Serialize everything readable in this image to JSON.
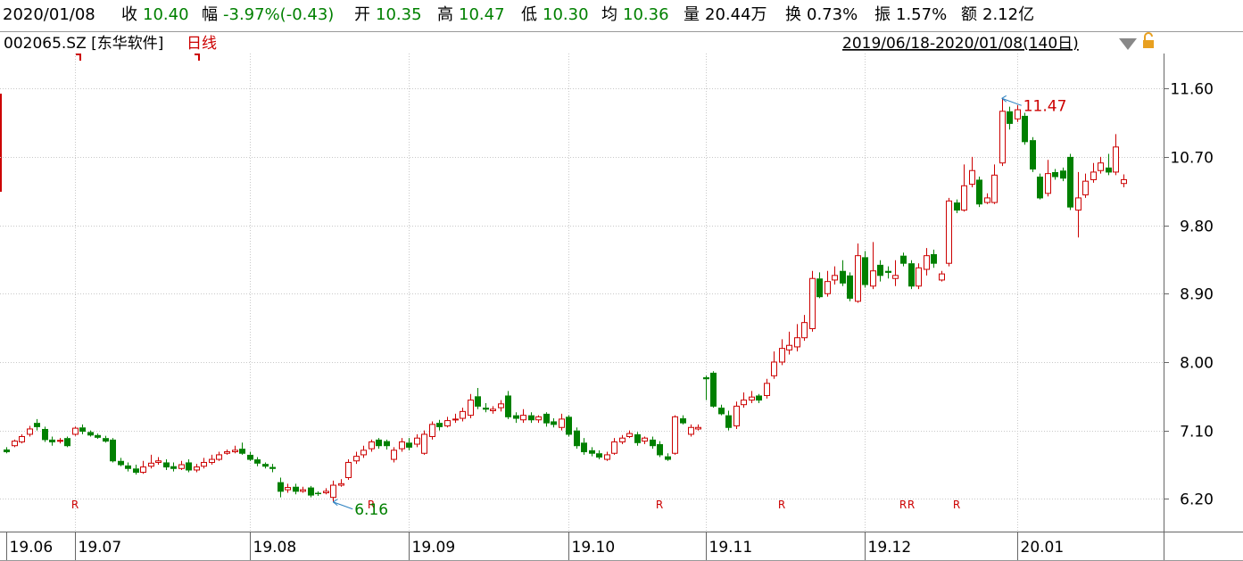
{
  "quote": {
    "date": "2020/01/08",
    "close_label": "收",
    "close": "10.40",
    "change_label": "幅",
    "change": "-3.97%(-0.43)",
    "open_label": "开",
    "open": "10.35",
    "high_label": "高",
    "high": "10.47",
    "low_label": "低",
    "low": "10.30",
    "avg_label": "均",
    "avg": "10.36",
    "vol_label": "量",
    "vol": "20.44万",
    "turnover_label": "换",
    "turnover": "0.73%",
    "amplitude_label": "振",
    "amplitude": "1.57%",
    "amount_label": "额",
    "amount": "2.12亿"
  },
  "header": {
    "symbol": "002065.SZ [东华软件]",
    "period": "日线",
    "range": "2019/06/18-2020/01/08(140日)",
    "dropdown_icon": "triangle-down-icon",
    "lock_icon": "lock-icon"
  },
  "colors": {
    "up": "#cc0000",
    "down": "#008000",
    "grid": "#c8c8c8",
    "annotation": "#2a80c0",
    "price_high": "#cc0000",
    "price_low": "#008000"
  },
  "chart_data": {
    "type": "candlestick",
    "yticks": [
      "11.60",
      "10.70",
      "9.80",
      "8.90",
      "8.00",
      "7.10",
      "6.20"
    ],
    "ylim": [
      5.77,
      12.06
    ],
    "xticks": [
      "19.06",
      "19.07",
      "19.08",
      "19.09",
      "19.10",
      "19.11",
      "19.12",
      "20.01"
    ],
    "grid": true,
    "annotations": [
      {
        "label": "11.47",
        "type": "high"
      },
      {
        "label": "6.16",
        "type": "low"
      }
    ],
    "markers": [
      "R",
      "R",
      "R",
      "R",
      "R",
      "R",
      "R"
    ],
    "candles": [
      [
        6.85,
        6.82,
        6.88,
        6.8
      ],
      [
        6.9,
        6.96,
        6.98,
        6.88
      ],
      [
        6.95,
        7.02,
        7.05,
        6.93
      ],
      [
        7.05,
        7.12,
        7.16,
        7.02
      ],
      [
        7.2,
        7.15,
        7.25,
        7.1
      ],
      [
        7.12,
        6.98,
        7.15,
        6.95
      ],
      [
        6.98,
        6.95,
        7.02,
        6.9
      ],
      [
        6.96,
        6.97,
        7.0,
        6.93
      ],
      [
        7.0,
        6.9,
        7.02,
        6.88
      ],
      [
        7.05,
        7.13,
        7.15,
        7.03
      ],
      [
        7.14,
        7.09,
        7.18,
        7.05
      ],
      [
        7.08,
        7.04,
        7.1,
        7.02
      ],
      [
        7.04,
        7.01,
        7.06,
        6.99
      ],
      [
        7.0,
        6.96,
        7.03,
        6.94
      ],
      [
        6.98,
        6.7,
        7.0,
        6.68
      ],
      [
        6.7,
        6.65,
        6.74,
        6.63
      ],
      [
        6.64,
        6.6,
        6.68,
        6.56
      ],
      [
        6.6,
        6.55,
        6.65,
        6.52
      ],
      [
        6.55,
        6.62,
        6.7,
        6.53
      ],
      [
        6.63,
        6.67,
        6.78,
        6.6
      ],
      [
        6.68,
        6.7,
        6.75,
        6.65
      ],
      [
        6.68,
        6.62,
        6.72,
        6.58
      ],
      [
        6.63,
        6.6,
        6.68,
        6.56
      ],
      [
        6.6,
        6.65,
        6.7,
        6.58
      ],
      [
        6.68,
        6.58,
        6.72,
        6.55
      ],
      [
        6.58,
        6.62,
        6.66,
        6.55
      ],
      [
        6.63,
        6.68,
        6.74,
        6.6
      ],
      [
        6.68,
        6.72,
        6.78,
        6.65
      ],
      [
        6.72,
        6.78,
        6.82,
        6.7
      ],
      [
        6.8,
        6.82,
        6.85,
        6.78
      ],
      [
        6.82,
        6.84,
        6.9,
        6.8
      ],
      [
        6.86,
        6.8,
        6.94,
        6.78
      ],
      [
        6.78,
        6.72,
        6.82,
        6.7
      ],
      [
        6.72,
        6.67,
        6.75,
        6.63
      ],
      [
        6.66,
        6.63,
        6.68,
        6.6
      ],
      [
        6.62,
        6.6,
        6.66,
        6.55
      ],
      [
        6.42,
        6.3,
        6.48,
        6.22
      ],
      [
        6.32,
        6.35,
        6.4,
        6.28
      ],
      [
        6.36,
        6.3,
        6.4,
        6.26
      ],
      [
        6.3,
        6.32,
        6.36,
        6.28
      ],
      [
        6.35,
        6.25,
        6.37,
        6.22
      ],
      [
        6.28,
        6.27,
        6.3,
        6.24
      ],
      [
        6.28,
        6.3,
        6.34,
        6.26
      ],
      [
        6.22,
        6.38,
        6.44,
        6.16
      ],
      [
        6.38,
        6.4,
        6.46,
        6.36
      ],
      [
        6.48,
        6.68,
        6.72,
        6.45
      ],
      [
        6.7,
        6.76,
        6.82,
        6.66
      ],
      [
        6.78,
        6.84,
        6.9,
        6.74
      ],
      [
        6.86,
        6.95,
        6.98,
        6.82
      ],
      [
        6.98,
        6.9,
        7.0,
        6.86
      ],
      [
        6.96,
        6.9,
        6.98,
        6.85
      ],
      [
        6.72,
        6.84,
        6.88,
        6.68
      ],
      [
        6.86,
        6.95,
        7.0,
        6.82
      ],
      [
        6.94,
        6.88,
        7.0,
        6.84
      ],
      [
        6.92,
        7.0,
        7.05,
        6.88
      ],
      [
        6.8,
        7.05,
        7.1,
        6.78
      ],
      [
        7.02,
        7.18,
        7.22,
        6.98
      ],
      [
        7.2,
        7.15,
        7.24,
        7.1
      ],
      [
        7.16,
        7.23,
        7.28,
        7.14
      ],
      [
        7.24,
        7.25,
        7.32,
        7.2
      ],
      [
        7.26,
        7.35,
        7.4,
        7.22
      ],
      [
        7.3,
        7.5,
        7.58,
        7.26
      ],
      [
        7.55,
        7.42,
        7.66,
        7.38
      ],
      [
        7.4,
        7.38,
        7.46,
        7.34
      ],
      [
        7.36,
        7.38,
        7.42,
        7.32
      ],
      [
        7.4,
        7.45,
        7.5,
        7.35
      ],
      [
        7.56,
        7.28,
        7.62,
        7.25
      ],
      [
        7.3,
        7.26,
        7.34,
        7.2
      ],
      [
        7.24,
        7.3,
        7.38,
        7.2
      ],
      [
        7.3,
        7.24,
        7.34,
        7.2
      ],
      [
        7.24,
        7.28,
        7.3,
        7.2
      ],
      [
        7.32,
        7.2,
        7.34,
        7.15
      ],
      [
        7.22,
        7.18,
        7.26,
        7.14
      ],
      [
        7.14,
        7.25,
        7.32,
        7.1
      ],
      [
        7.28,
        7.05,
        7.3,
        7.02
      ],
      [
        7.1,
        6.9,
        7.14,
        6.86
      ],
      [
        6.94,
        6.82,
        7.0,
        6.78
      ],
      [
        6.84,
        6.8,
        6.88,
        6.76
      ],
      [
        6.8,
        6.75,
        6.84,
        6.72
      ],
      [
        6.72,
        6.78,
        6.82,
        6.7
      ],
      [
        6.8,
        6.95,
        7.0,
        6.78
      ],
      [
        6.95,
        7.0,
        7.04,
        6.92
      ],
      [
        7.02,
        7.06,
        7.1,
        7.0
      ],
      [
        7.05,
        6.94,
        7.08,
        6.9
      ],
      [
        6.96,
        7.0,
        7.02,
        6.92
      ],
      [
        6.98,
        6.9,
        7.02,
        6.86
      ],
      [
        6.92,
        6.78,
        6.96,
        6.75
      ],
      [
        6.76,
        6.72,
        6.8,
        6.7
      ],
      [
        6.8,
        7.28,
        7.3,
        6.78
      ],
      [
        7.26,
        7.2,
        7.3,
        7.18
      ],
      [
        7.05,
        7.14,
        7.18,
        7.02
      ],
      [
        7.12,
        7.14,
        7.18,
        7.1
      ],
      [
        7.8,
        7.78,
        7.82,
        7.5
      ],
      [
        7.86,
        7.42,
        7.88,
        7.4
      ],
      [
        7.4,
        7.32,
        7.44,
        7.3
      ],
      [
        7.3,
        7.14,
        7.36,
        7.1
      ],
      [
        7.16,
        7.42,
        7.48,
        7.12
      ],
      [
        7.44,
        7.5,
        7.6,
        7.4
      ],
      [
        7.5,
        7.54,
        7.62,
        7.46
      ],
      [
        7.56,
        7.5,
        7.58,
        7.46
      ],
      [
        7.56,
        7.72,
        7.78,
        7.52
      ],
      [
        7.82,
        8.0,
        8.14,
        7.78
      ],
      [
        8.0,
        8.18,
        8.3,
        7.96
      ],
      [
        8.16,
        8.22,
        8.4,
        8.1
      ],
      [
        8.2,
        8.32,
        8.5,
        8.14
      ],
      [
        8.32,
        8.52,
        8.62,
        8.28
      ],
      [
        8.44,
        9.1,
        9.2,
        8.4
      ],
      [
        9.1,
        8.86,
        9.18,
        8.84
      ],
      [
        8.9,
        9.06,
        9.2,
        8.86
      ],
      [
        9.08,
        9.14,
        9.26,
        9.02
      ],
      [
        9.2,
        9.04,
        9.34,
        9.0
      ],
      [
        9.14,
        8.84,
        9.18,
        8.8
      ],
      [
        8.8,
        9.4,
        9.56,
        8.78
      ],
      [
        9.38,
        9.02,
        9.46,
        8.98
      ],
      [
        9.0,
        9.2,
        9.58,
        8.96
      ],
      [
        9.28,
        9.14,
        9.34,
        9.06
      ],
      [
        9.2,
        9.18,
        9.26,
        9.1
      ],
      [
        9.1,
        9.14,
        9.34,
        9.0
      ],
      [
        9.4,
        9.3,
        9.44,
        9.26
      ],
      [
        9.3,
        9.0,
        9.34,
        8.96
      ],
      [
        9.0,
        9.24,
        9.3,
        8.96
      ],
      [
        9.22,
        9.4,
        9.5,
        9.14
      ],
      [
        9.42,
        9.3,
        9.48,
        9.24
      ],
      [
        9.08,
        9.16,
        9.2,
        9.06
      ],
      [
        9.3,
        10.12,
        10.16,
        9.26
      ],
      [
        10.1,
        10.0,
        10.14,
        9.96
      ],
      [
        10.0,
        10.32,
        10.6,
        9.98
      ],
      [
        10.34,
        10.52,
        10.7,
        10.3
      ],
      [
        10.4,
        10.08,
        10.44,
        10.04
      ],
      [
        10.1,
        10.16,
        10.22,
        10.08
      ],
      [
        10.1,
        10.46,
        10.6,
        10.08
      ],
      [
        10.62,
        11.3,
        11.47,
        10.58
      ],
      [
        11.3,
        11.14,
        11.36,
        11.06
      ],
      [
        11.2,
        11.32,
        11.38,
        11.16
      ],
      [
        11.24,
        10.9,
        11.28,
        10.86
      ],
      [
        10.92,
        10.54,
        10.96,
        10.5
      ],
      [
        10.44,
        10.16,
        10.48,
        10.14
      ],
      [
        10.22,
        10.48,
        10.66,
        10.18
      ],
      [
        10.5,
        10.44,
        10.54,
        10.4
      ],
      [
        10.52,
        10.42,
        10.56,
        10.38
      ],
      [
        10.7,
        10.04,
        10.74,
        10.0
      ],
      [
        10.0,
        10.16,
        10.5,
        9.64
      ],
      [
        10.2,
        10.38,
        10.48,
        10.16
      ],
      [
        10.4,
        10.5,
        10.62,
        10.36
      ],
      [
        10.52,
        10.62,
        10.7,
        10.48
      ],
      [
        10.56,
        10.5,
        10.74,
        10.46
      ],
      [
        10.5,
        10.83,
        11.0,
        10.46
      ],
      [
        10.35,
        10.4,
        10.47,
        10.3
      ]
    ]
  }
}
